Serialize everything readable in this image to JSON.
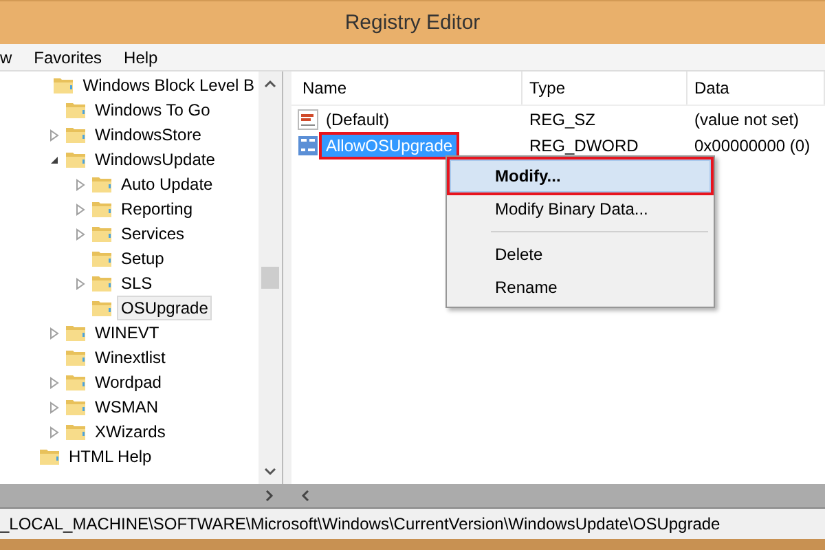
{
  "window": {
    "title": "Registry Editor"
  },
  "menu": [
    "w",
    "Favorites",
    "Help"
  ],
  "tree": {
    "items": [
      {
        "children": [
          {
            "label": "Windows Block Level B",
            "selected": false
          },
          {
            "label": "Windows To Go",
            "selected": false
          },
          {
            "label": "WindowsStore",
            "expanded": false,
            "selected": false
          },
          {
            "label": "WindowsUpdate",
            "expanded": true,
            "selected": false,
            "children": [
              {
                "label": "Auto Update",
                "expanded": false,
                "selected": false
              },
              {
                "label": "Reporting",
                "expanded": false,
                "selected": false
              },
              {
                "label": "Services",
                "expanded": false,
                "selected": false
              },
              {
                "label": "Setup",
                "selected": false
              },
              {
                "label": "SLS",
                "expanded": false,
                "selected": false
              },
              {
                "label": "OSUpgrade",
                "selected": true
              }
            ]
          },
          {
            "label": "WINEVT",
            "expanded": false,
            "selected": false
          },
          {
            "label": "Winextlist",
            "selected": false
          },
          {
            "label": "Wordpad",
            "expanded": false,
            "selected": false
          },
          {
            "label": "WSMAN",
            "expanded": false,
            "selected": false
          },
          {
            "label": "XWizards",
            "expanded": false,
            "selected": false
          }
        ]
      },
      {
        "label": "HTML Help",
        "selected": false
      }
    ]
  },
  "table": {
    "columns": [
      "Name",
      "Type",
      "Data"
    ],
    "rows": [
      {
        "kind": "string",
        "name": "(Default)",
        "type": "REG_SZ",
        "data": "(value not set)",
        "selected": false,
        "highlighted": false
      },
      {
        "kind": "binary",
        "name": "AllowOSUpgrade",
        "type": "REG_DWORD",
        "data": "0x00000000 (0)",
        "selected": true,
        "highlighted": true
      }
    ]
  },
  "context_menu": {
    "items": [
      {
        "kind": "item",
        "label": "Modify...",
        "selected": true,
        "highlighted": true
      },
      {
        "kind": "item",
        "label": "Modify Binary Data...",
        "selected": false,
        "highlighted": false
      },
      {
        "kind": "separator"
      },
      {
        "kind": "item",
        "label": "Delete",
        "selected": false,
        "highlighted": false
      },
      {
        "kind": "item",
        "label": "Rename",
        "selected": false,
        "highlighted": false
      }
    ]
  },
  "status_bar": {
    "path": "_LOCAL_MACHINE\\SOFTWARE\\Microsoft\\Windows\\CurrentVersion\\WindowsUpdate\\OSUpgrade"
  }
}
